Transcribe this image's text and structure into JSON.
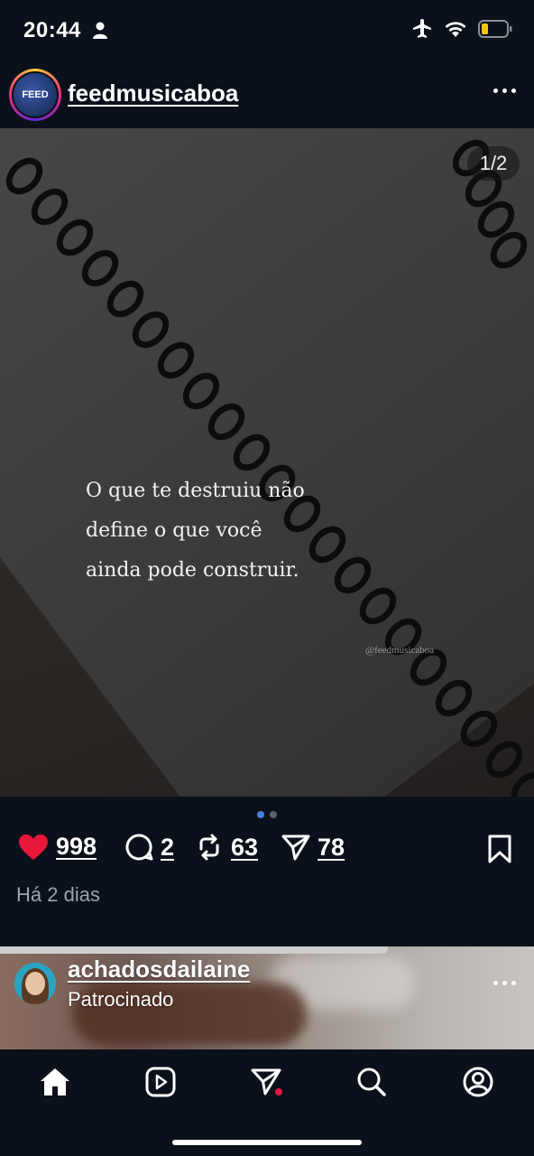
{
  "status_bar": {
    "time": "20:44",
    "icons": [
      "person-icon",
      "airplane-icon",
      "wifi-icon",
      "battery-icon"
    ],
    "battery_color": "#f5c400"
  },
  "post": {
    "username": "feedmusicaboa",
    "avatar_text": "FEED",
    "page_counter": "1/2",
    "quote_lines": [
      "O que te destruiu não",
      "define o que você",
      "ainda pode construir."
    ],
    "watermark": "@feedmusicaboa",
    "carousel": {
      "count": 2,
      "active": 0
    },
    "likes": "998",
    "comments": "2",
    "reposts": "63",
    "shares": "78",
    "time_ago": "Há 2 dias",
    "like_color": "#e8173a"
  },
  "next_post": {
    "username": "achadosdailaine",
    "label": "Patrocinado"
  },
  "nav": {
    "items": [
      "home-icon",
      "reels-icon",
      "send-icon",
      "search-icon",
      "profile-icon"
    ],
    "notification_dot_color": "#e8173a"
  }
}
